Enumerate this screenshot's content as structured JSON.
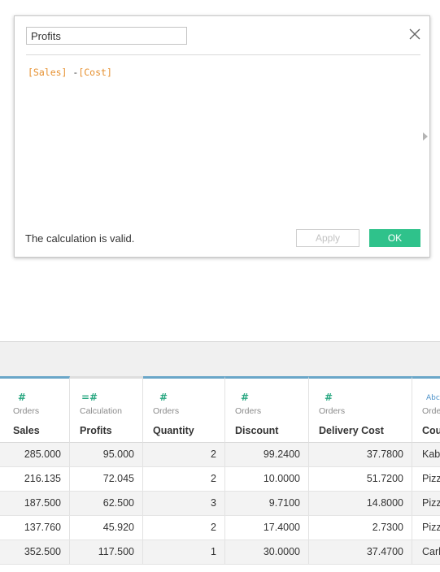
{
  "dialog": {
    "calc_name": "Profits",
    "formula": {
      "field1": "[Sales]",
      "operator": " -",
      "field2": "[Cost]"
    },
    "status": "The calculation is valid.",
    "apply_label": "Apply",
    "ok_label": "OK",
    "colors": {
      "field": "#e6902f",
      "ok_button": "#2fc28b"
    }
  },
  "grid": {
    "columns": [
      {
        "icon": "#",
        "source": "Orders",
        "name": "Sales"
      },
      {
        "icon": "=#",
        "source": "Calculation",
        "name": "Profits"
      },
      {
        "icon": "#",
        "source": "Orders",
        "name": "Quantity"
      },
      {
        "icon": "#",
        "source": "Orders",
        "name": "Discount"
      },
      {
        "icon": "#",
        "source": "Orders",
        "name": "Delivery Cost"
      },
      {
        "icon": "Abc",
        "source": "Orde",
        "name": "Cou"
      }
    ],
    "rows": [
      [
        "285.000",
        "95.000",
        "2",
        "99.2400",
        "37.7800",
        "Kab"
      ],
      [
        "216.135",
        "72.045",
        "2",
        "10.0000",
        "51.7200",
        "Pizz"
      ],
      [
        "187.500",
        "62.500",
        "3",
        "9.7100",
        "14.8000",
        "Pizz"
      ],
      [
        "137.760",
        "45.920",
        "2",
        "17.4000",
        "2.7300",
        "Pizz"
      ],
      [
        "352.500",
        "117.500",
        "1",
        "30.0000",
        "37.4700",
        "Carl"
      ]
    ]
  }
}
